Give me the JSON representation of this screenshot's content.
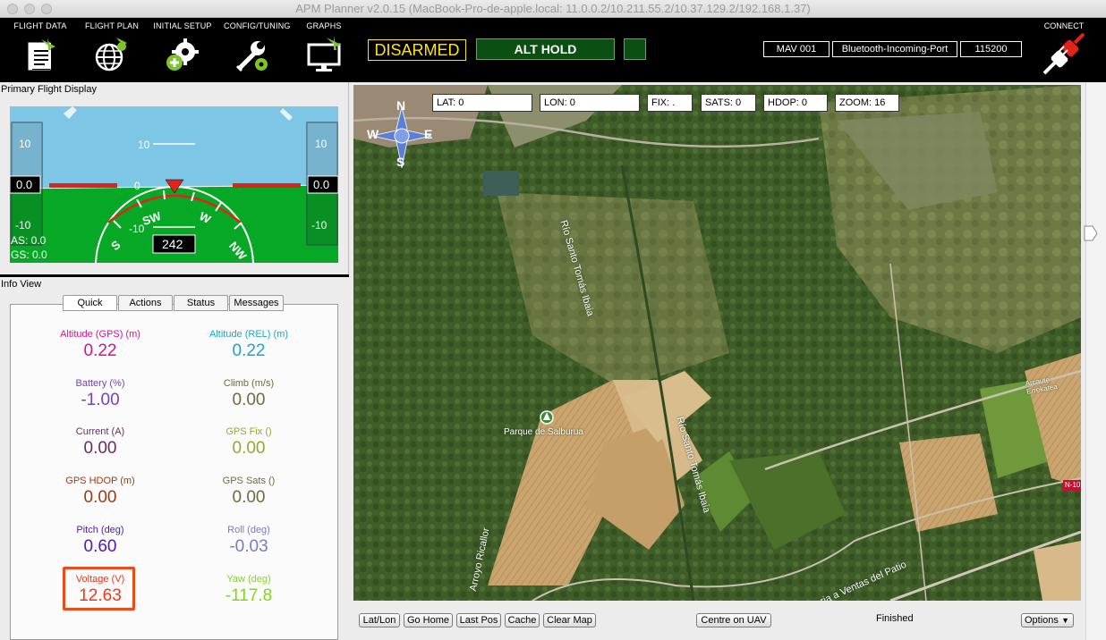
{
  "window": {
    "title": "APM Planner v2.0.15 (MacBook-Pro-de-apple.local: 11.0.0.2/10.211.55.2/10.37.129.2/192.168.1.37)"
  },
  "toolbar": {
    "items": [
      {
        "label": "FLIGHT DATA",
        "icon": "flight-data-icon"
      },
      {
        "label": "FLIGHT PLAN",
        "icon": "flight-plan-icon"
      },
      {
        "label": "INITIAL SETUP",
        "icon": "initial-setup-icon"
      },
      {
        "label": "CONFIG/TUNING",
        "icon": "config-tuning-icon"
      },
      {
        "label": "GRAPHS",
        "icon": "graphs-icon"
      }
    ],
    "arm_status": "DISARMED",
    "flight_mode": "ALT HOLD",
    "mav_id": "MAV 001",
    "port": "Bluetooth-Incoming-Port",
    "baud": "115200",
    "connect_label": "CONNECT",
    "colors": {
      "arm_status": "#ffe600",
      "mode_bg": "#0c4f12"
    }
  },
  "pfd": {
    "title": "Primary Flight Display",
    "pitch_labels": [
      "10",
      "0",
      "-10"
    ],
    "alt_ticks": [
      "10",
      "-10"
    ],
    "left_value": "0.0",
    "right_value": "0.0",
    "heading": "242",
    "compass_labels": [
      "SW",
      "W",
      "S",
      "NW"
    ],
    "as_label": "AS: 0.0",
    "gs_label": "GS: 0.0"
  },
  "info": {
    "title": "Info View",
    "tabs": [
      "Quick",
      "Actions",
      "Status",
      "Messages"
    ],
    "items": [
      {
        "label": "Altitude (GPS) (m)",
        "value": "0.22",
        "color": "#d4148c"
      },
      {
        "label": "Altitude (REL) (m)",
        "value": "0.22",
        "color": "#1aa6c4"
      },
      {
        "label": "Battery (%)",
        "value": "-1.00",
        "color": "#7444b8"
      },
      {
        "label": "Climb (m/s)",
        "value": "0.00",
        "color": "#6f6a3f"
      },
      {
        "label": "Current (A)",
        "value": "0.00",
        "color": "#6b2a66"
      },
      {
        "label": "GPS Fix ()",
        "value": "0.00",
        "color": "#9aa43a"
      },
      {
        "label": "GPS HDOP (m)",
        "value": "0.00",
        "color": "#9a3a12"
      },
      {
        "label": "GPS Sats ()",
        "value": "0.00",
        "color": "#6f6a3f"
      },
      {
        "label": "Pitch (deg)",
        "value": "0.60",
        "color": "#4a1ab8"
      },
      {
        "label": "Roll (deg)",
        "value": "-0.03",
        "color": "#7a7ac8"
      },
      {
        "label": "Voltage (V)",
        "value": "12.63",
        "color": "#f0381a"
      },
      {
        "label": "Yaw (deg)",
        "value": "-117.8",
        "color": "#84d41a"
      }
    ]
  },
  "map": {
    "gps": {
      "lat": "LAT: 0",
      "lon": "LON: 0",
      "fix": "FIX: .",
      "sats": "SATS: 0",
      "hdop": "HDOP: 0",
      "zoom": "ZOOM: 16"
    },
    "compass": {
      "n": "N",
      "s": "S",
      "e": "E",
      "w": "W"
    },
    "labels": {
      "rio1": "Río Santo Tomás Ibaia",
      "rio2": "Río Santo Tomás Ibaia",
      "parque": "Parque de Salburua",
      "arroyo": "Arroyo Ricallor",
      "ventas": "ria a Ventas del Patio",
      "arcaute": "Arcaute Errekatea",
      "road": "N-10"
    },
    "buttons": {
      "latlon": "Lat/Lon",
      "gohome": "Go Home",
      "lastpos": "Last Pos",
      "cache": "Cache",
      "clearmap": "Clear Map",
      "centre": "Centre on UAV",
      "options": "Options"
    },
    "status": "Finished"
  }
}
